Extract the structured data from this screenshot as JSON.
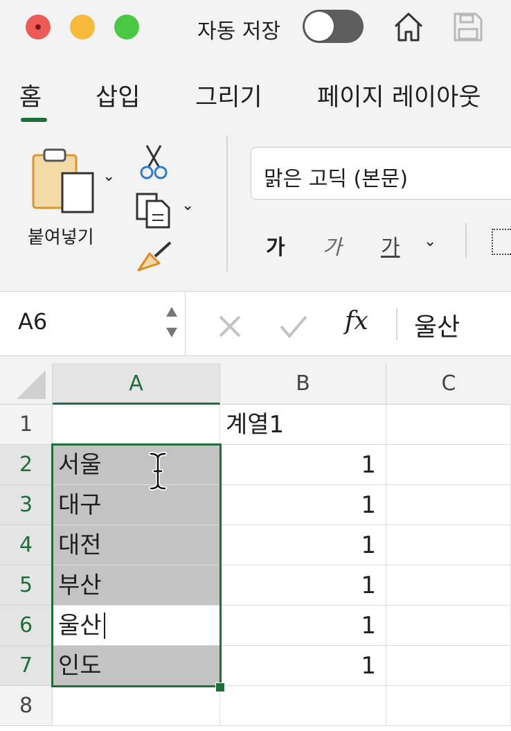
{
  "title_bar": {
    "autosave_label": "자동 저장",
    "autosave_on": false,
    "colors": {
      "close": "#ed5b56",
      "minimize": "#f6b93b",
      "zoom": "#4ac843"
    }
  },
  "tabs": [
    {
      "label": "홈",
      "active": true
    },
    {
      "label": "삽입",
      "active": false
    },
    {
      "label": "그리기",
      "active": false
    },
    {
      "label": "페이지 레이아웃",
      "active": false
    }
  ],
  "ribbon": {
    "paste_label": "붙여넣기",
    "font_name": "맑은 고딕 (본문)",
    "bold_label": "가",
    "italic_label": "가",
    "underline_label": "가"
  },
  "formula_bar": {
    "name_box": "A6",
    "fx_label": "fx",
    "content": "울산"
  },
  "sheet": {
    "columns": [
      "A",
      "B",
      "C"
    ],
    "rows": [
      {
        "num": "1",
        "a": "",
        "b": "계열1"
      },
      {
        "num": "2",
        "a": "서울",
        "b": "1"
      },
      {
        "num": "3",
        "a": "대구",
        "b": "1"
      },
      {
        "num": "4",
        "a": "대전",
        "b": "1"
      },
      {
        "num": "5",
        "a": "부산",
        "b": "1"
      },
      {
        "num": "6",
        "a": "울산",
        "b": "1"
      },
      {
        "num": "7",
        "a": "인도",
        "b": "1"
      },
      {
        "num": "8",
        "a": "",
        "b": ""
      }
    ],
    "selection_color": "#1e6e3a",
    "highlight_color": "#c3c3c3"
  }
}
